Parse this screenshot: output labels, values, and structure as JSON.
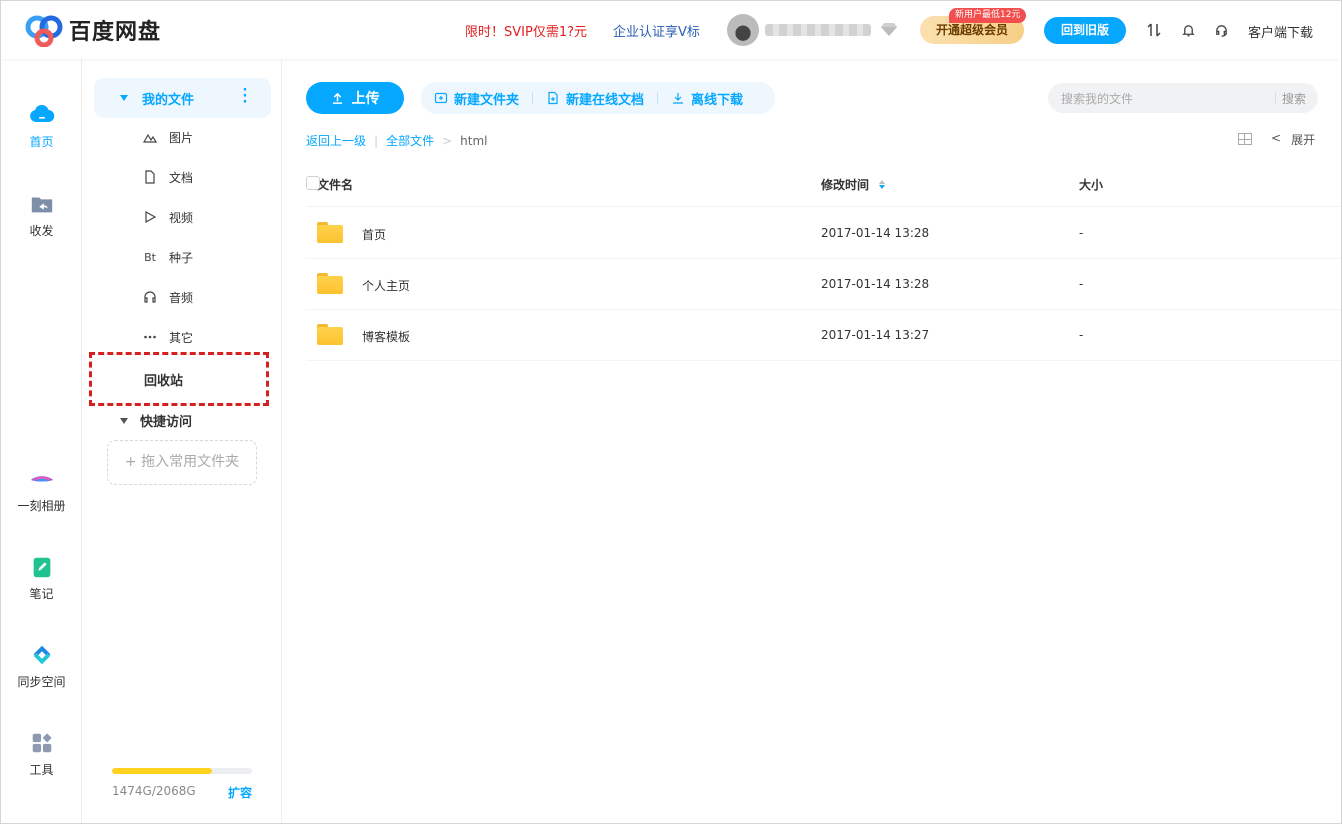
{
  "header": {
    "logo_text": "百度网盘",
    "promo_vip": "限时！SVIP仅需1?元",
    "promo_enterprise": "企业认证享V标",
    "vip_badge": "新用户最低12元",
    "vip_button": "开通超级会员",
    "old_version_button": "回到旧版",
    "client_download": "客户端下载",
    "icons": [
      "transfer-icon",
      "bell-icon",
      "headset-icon"
    ],
    "brand_color": "#06a7ff"
  },
  "leftnav": {
    "items": [
      {
        "label": "首页",
        "icon": "cloud-icon",
        "active": true
      },
      {
        "label": "收发",
        "icon": "share-folder-icon",
        "active": false
      },
      {
        "label": "一刻相册",
        "icon": "album-icon",
        "active": false
      },
      {
        "label": "笔记",
        "icon": "note-icon",
        "active": false
      },
      {
        "label": "同步空间",
        "icon": "sync-icon",
        "active": false
      },
      {
        "label": "工具",
        "icon": "tools-icon",
        "active": false
      }
    ]
  },
  "sidebar": {
    "my_files": "我的文件",
    "categories": [
      {
        "label": "图片",
        "icon": "image-icon"
      },
      {
        "label": "文档",
        "icon": "document-icon"
      },
      {
        "label": "视频",
        "icon": "play-icon"
      },
      {
        "label": "种子",
        "icon": "bt-icon",
        "glyph": "Bt"
      },
      {
        "label": "音频",
        "icon": "headphones-icon"
      },
      {
        "label": "其它",
        "icon": "more-icon"
      }
    ],
    "recycle_bin": "回收站",
    "quick_access": "快捷访问",
    "drop_favorite": "+ 拖入常用文件夹",
    "storage_text": "1474G/2068G",
    "storage_used_fraction": 0.7128,
    "expand_link": "扩容"
  },
  "toolbar": {
    "upload": "上传",
    "new_folder": "新建文件夹",
    "new_online_doc": "新建在线文档",
    "offline_download": "离线下载",
    "search_placeholder": "搜索我的文件",
    "search_button": "搜索"
  },
  "breadcrumb": {
    "back": "返回上一级",
    "all_files": "全部文件",
    "current": "html"
  },
  "view": {
    "expand": "展开"
  },
  "table": {
    "columns": {
      "name": "文件名",
      "modified": "修改时间",
      "size": "大小"
    },
    "rows": [
      {
        "name": "首页",
        "modified": "2017-01-14 13:28",
        "size": "-"
      },
      {
        "name": "个人主页",
        "modified": "2017-01-14 13:28",
        "size": "-"
      },
      {
        "name": "博客模板",
        "modified": "2017-01-14 13:27",
        "size": "-"
      }
    ]
  }
}
